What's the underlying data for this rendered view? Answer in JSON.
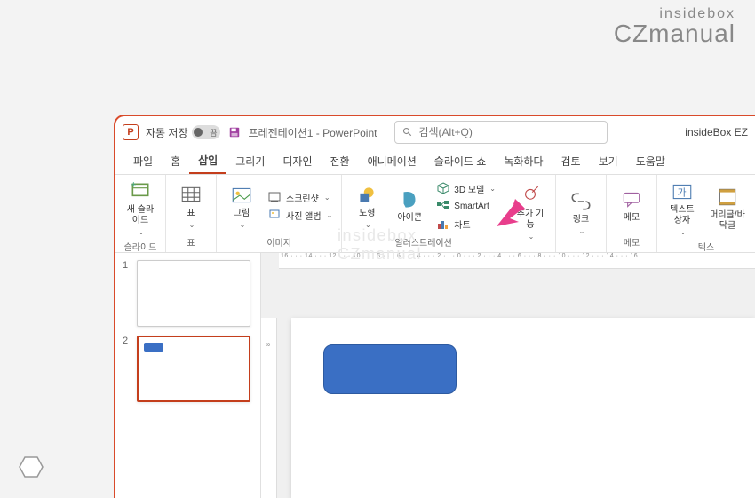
{
  "watermark": {
    "line1": "insidebox",
    "line2": "CZmanual"
  },
  "titlebar": {
    "autosave_label": "자동 저장",
    "autosave_state": "끔",
    "doc_name": "프레젠테이션1",
    "app_suffix": " - PowerPoint",
    "search_placeholder": "검색(Alt+Q)",
    "account": "insideBox EZ"
  },
  "tabs": [
    {
      "label": "파일",
      "active": false
    },
    {
      "label": "홈",
      "active": false
    },
    {
      "label": "삽입",
      "active": true
    },
    {
      "label": "그리기",
      "active": false
    },
    {
      "label": "디자인",
      "active": false
    },
    {
      "label": "전환",
      "active": false
    },
    {
      "label": "애니메이션",
      "active": false
    },
    {
      "label": "슬라이드 쇼",
      "active": false
    },
    {
      "label": "녹화하다",
      "active": false
    },
    {
      "label": "검토",
      "active": false
    },
    {
      "label": "보기",
      "active": false
    },
    {
      "label": "도움말",
      "active": false
    }
  ],
  "ribbon": {
    "groups": {
      "slides": {
        "new_slide": "새 슬라이드",
        "label": "슬라이드"
      },
      "tables": {
        "table": "표",
        "label": "표"
      },
      "images": {
        "pictures": "그림",
        "screenshot": "스크린샷",
        "album": "사진 앨범",
        "label": "이미지"
      },
      "illustrations": {
        "shapes": "도형",
        "icons": "아이콘",
        "model3d": "3D 모델",
        "smartart": "SmartArt",
        "chart": "차트",
        "label": "일러스트레이션"
      },
      "addins": {
        "addins": "추가 기능",
        "label": ""
      },
      "links": {
        "link": "링크",
        "label": ""
      },
      "comments": {
        "memo": "메모",
        "label": "메모"
      },
      "text": {
        "textbox": "텍스트 상자",
        "headerfooter": "머리글/바닥글",
        "label": "텍스"
      }
    }
  },
  "ruler": {
    "h": "16 · · · 14 · · · 12 · · · 10 · · · 8 · · · 6 · · · 4 · · · 2 · · · 0 · · · 2 · · · 4 · · · 6 · · · 8 · · · 10 · · · 12 · · · 14 · · · 16",
    "v": [
      "8"
    ]
  },
  "thumbs": [
    {
      "num": "1",
      "active": false,
      "shape": false
    },
    {
      "num": "2",
      "active": true,
      "shape": true
    }
  ]
}
